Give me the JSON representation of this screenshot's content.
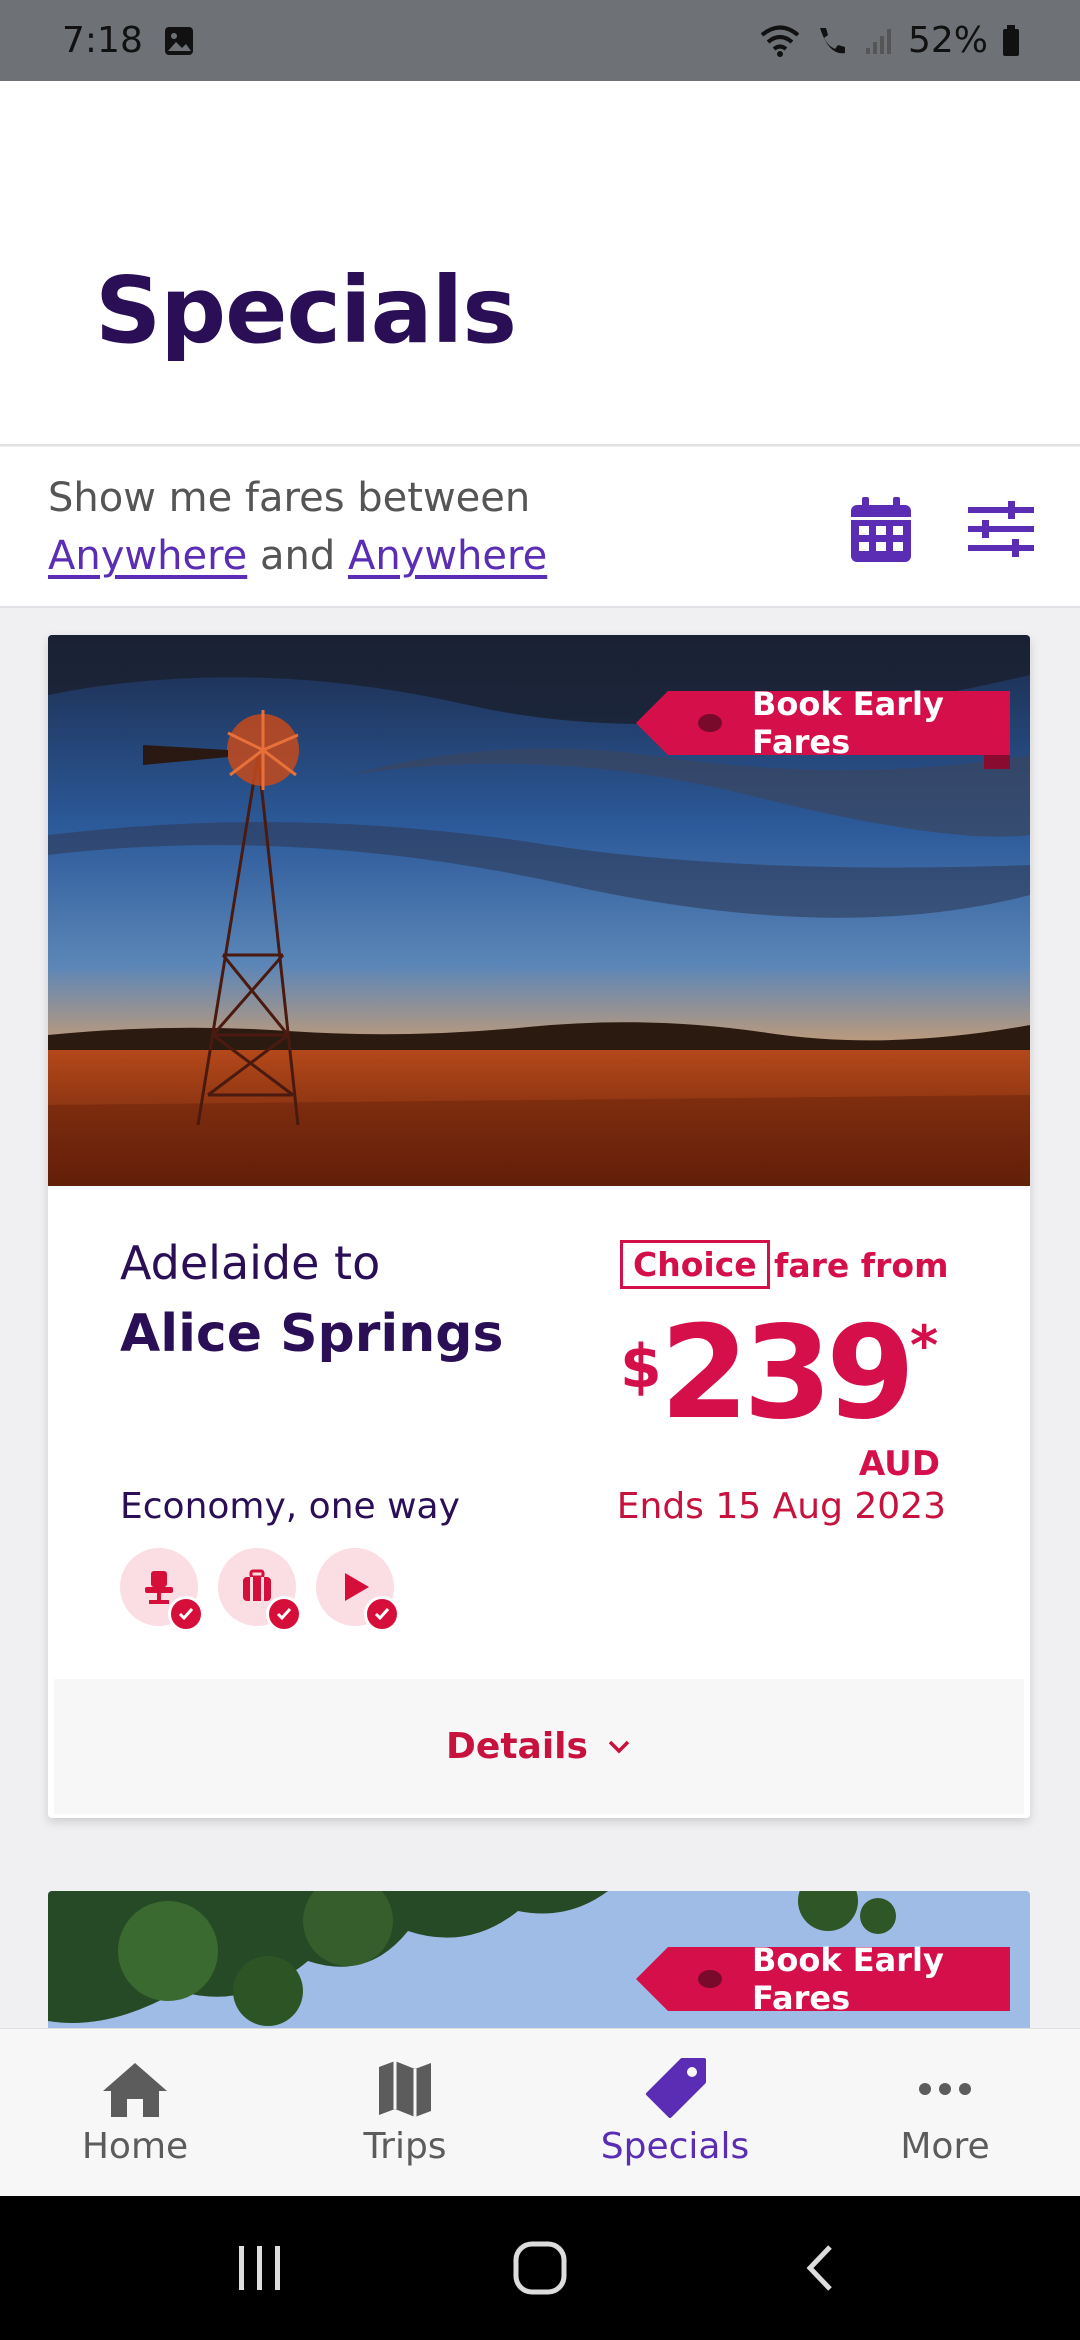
{
  "status_bar": {
    "time": "7:18",
    "battery": "52%"
  },
  "header": {
    "title": "Specials"
  },
  "filter": {
    "label": "Show me fares between",
    "from": "Anywhere",
    "connector": "and",
    "to": "Anywhere"
  },
  "cards": [
    {
      "ribbon": "Book Early Fares",
      "route_from": "Adelaide to",
      "route_to": "Alice Springs",
      "fare_tag": "Choice",
      "fare_from": "fare from",
      "currency_symbol": "$",
      "price": "239",
      "price_note": "*",
      "currency": "AUD",
      "fare_class": "Economy, one way",
      "ends": "Ends 15 Aug 2023",
      "amenities": [
        "seat-icon",
        "baggage-icon",
        "entertainment-icon"
      ],
      "details_label": "Details"
    },
    {
      "ribbon": "Book Early Fares"
    }
  ],
  "bottom_nav": {
    "items": [
      {
        "label": "Home",
        "icon": "home-icon",
        "active": false
      },
      {
        "label": "Trips",
        "icon": "map-icon",
        "active": false
      },
      {
        "label": "Specials",
        "icon": "tag-icon",
        "active": true
      },
      {
        "label": "More",
        "icon": "more-icon",
        "active": false
      }
    ]
  },
  "colors": {
    "brand_purple": "#2a0e56",
    "accent_purple": "#5a2db4",
    "accent_red": "#d50f4a"
  }
}
